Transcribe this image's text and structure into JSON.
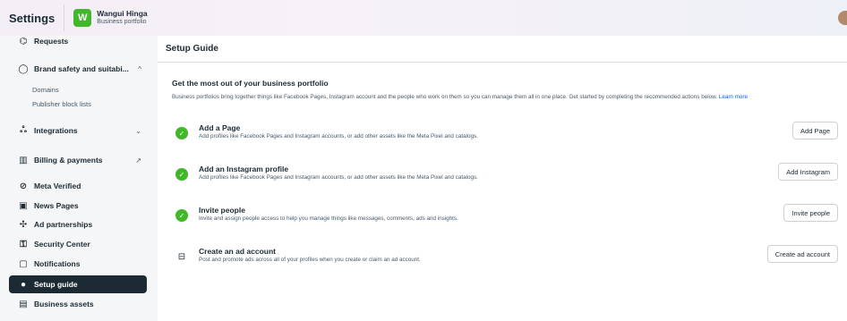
{
  "header": {
    "app_title": "Settings",
    "portfolio_initial": "W",
    "portfolio_name": "Wangui Hinga",
    "portfolio_sub": "Business portfolio"
  },
  "sidebar": {
    "items": [
      {
        "label": "Requests",
        "icon": "requests-icon"
      },
      {
        "label": "Brand safety and suitabi...",
        "icon": "shield-icon",
        "trail": "^"
      },
      {
        "label": "Domains"
      },
      {
        "label": "Publisher block lists"
      },
      {
        "label": "Integrations",
        "icon": "integrations-icon",
        "trail": "⌄"
      },
      {
        "label": "Billing & payments",
        "icon": "bank-icon",
        "trail": "↗"
      },
      {
        "label": "Meta Verified",
        "icon": "verified-icon"
      },
      {
        "label": "News Pages",
        "icon": "news-icon"
      },
      {
        "label": "Ad partnerships",
        "icon": "handshake-icon"
      },
      {
        "label": "Security Center",
        "icon": "lock-icon"
      },
      {
        "label": "Notifications",
        "icon": "bell-icon"
      },
      {
        "label": "Setup guide",
        "icon": "setup-guide-icon"
      },
      {
        "label": "Business assets",
        "icon": "briefcase-icon"
      }
    ]
  },
  "main": {
    "title": "Setup Guide",
    "intro_title": "Get the most out of your business portfolio",
    "intro_text": "Business portfolios bring together things like Facebook Pages, Instagram account and the people who work on them so you can manage them all in one place. Get started by completing the recommended actions below.",
    "learn_more": "Learn more",
    "tasks": [
      {
        "title": "Add a Page",
        "desc": "Add profiles like Facebook Pages and Instagram accounts, or add other assets like the Meta Pixel and catalogs.",
        "button": "Add Page",
        "done": true
      },
      {
        "title": "Add an Instagram profile",
        "desc": "Add profiles like Facebook Pages and Instagram accounts, or add other assets like the Meta Pixel and catalogs.",
        "button": "Add Instagram",
        "done": true
      },
      {
        "title": "Invite people",
        "desc": "Invite and assign people access to help you manage things like messages, comments, ads and insights.",
        "button": "Invite people",
        "done": true
      },
      {
        "title": "Create an ad account",
        "desc": "Post and promote ads across all of your profiles when you create or claim an ad account.",
        "button": "Create ad account",
        "done": false
      }
    ]
  },
  "colors": {
    "accent": "#0064e0",
    "success": "#42b72a",
    "active_bg": "#1c2b33"
  }
}
